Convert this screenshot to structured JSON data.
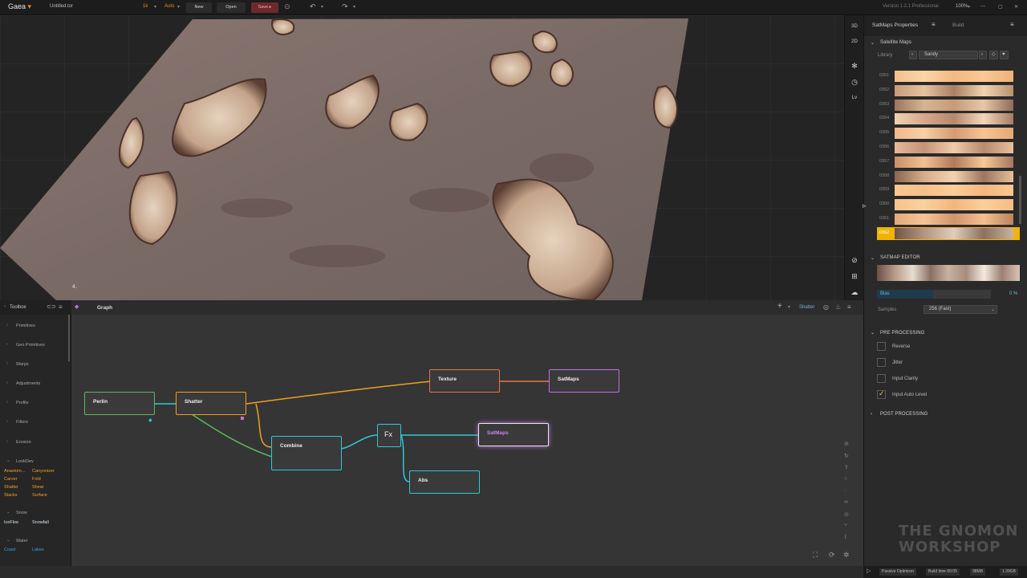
{
  "topbar": {
    "app_name": "Gaea",
    "file_name": "Untitled.tor",
    "resolution": "1k",
    "mode": "Auto",
    "new_label": "New",
    "open_label": "Open",
    "save_label": "Save ▸",
    "version": "Version 1.2.1 Professional",
    "zoom": "100%"
  },
  "viewport": {
    "tools": [
      "3D",
      "2D",
      "Lv"
    ]
  },
  "right_panel": {
    "tab_properties": "SatMaps Properties",
    "tab_build": "Build",
    "section_satellite": "Satellite Maps",
    "library_label": "Library",
    "library_value": "Sandy",
    "swatches": [
      {
        "id": "0351",
        "colors": [
          "#f3c08c",
          "#fad5a5",
          "#f4b881",
          "#f9c894",
          "#f0b07a"
        ]
      },
      {
        "id": "0352",
        "colors": [
          "#c79a78",
          "#e6c3a0",
          "#a87f64",
          "#f1d4b0",
          "#b89274"
        ]
      },
      {
        "id": "0353",
        "colors": [
          "#9b7560",
          "#d9b492",
          "#c69b79",
          "#e8c7a6",
          "#8e6b58"
        ]
      },
      {
        "id": "0354",
        "colors": [
          "#f0d2b4",
          "#d6a88a",
          "#b7876d",
          "#f4d6b9",
          "#a47b64"
        ]
      },
      {
        "id": "0355",
        "colors": [
          "#efb98b",
          "#f8d0a6",
          "#d49b73",
          "#f6c493",
          "#e8a874"
        ]
      },
      {
        "id": "0356",
        "colors": [
          "#e6b896",
          "#c49478",
          "#f1cba8",
          "#b88a6e",
          "#e9bf9b"
        ]
      },
      {
        "id": "0357",
        "colors": [
          "#c68f68",
          "#f2c094",
          "#b17a5a",
          "#f6c998",
          "#a6765c"
        ]
      },
      {
        "id": "0358",
        "colors": [
          "#8a6650",
          "#d8ad8a",
          "#f3d2b0",
          "#9c7660",
          "#e8bf99"
        ]
      },
      {
        "id": "0359",
        "colors": [
          "#fac890",
          "#f6c08a",
          "#fbcd98",
          "#f2b880",
          "#f9c68f"
        ]
      },
      {
        "id": "0360",
        "colors": [
          "#f7c28c",
          "#fbd19e",
          "#f3b57e",
          "#fbcf9a",
          "#f5bd86"
        ]
      },
      {
        "id": "0361",
        "colors": [
          "#e2a87c",
          "#f6c596",
          "#cf946c",
          "#f3bf8f",
          "#b9835f"
        ]
      },
      {
        "id": "0362",
        "colors": [
          "#6e5448",
          "#b39582",
          "#e0cdbd",
          "#8c7062",
          "#c9b3a3"
        ]
      }
    ],
    "section_editor": "SATMAP EDITOR",
    "bias_label": "Bias",
    "bias_value": "0 %",
    "samples_label": "Samples",
    "samples_value": "256 (Fast)",
    "section_pre": "PRE PROCESSING",
    "checks": [
      {
        "label": "Reverse",
        "checked": false
      },
      {
        "label": "Jitter",
        "checked": false
      },
      {
        "label": "Input Clarity",
        "checked": false
      },
      {
        "label": "Input Auto Level",
        "checked": true
      }
    ],
    "section_post": "POST PROCESSING"
  },
  "toolbox": {
    "title": "Toolbox",
    "categories": [
      "Primitives",
      "Geo Primitives",
      "Warps",
      "Adjustments",
      "Profile",
      "Filters",
      "Erosion",
      "LookDev",
      "Snow",
      "Water"
    ],
    "lookdev_nodes": [
      "Anastom...",
      "Canyonizer",
      "Carver",
      "Fold",
      "Shatter",
      "Shear",
      "Stacks",
      "Surface"
    ],
    "snow_nodes": [
      "IceFloe",
      "Snowfall"
    ],
    "water_nodes": [
      "Coast",
      "Lakes"
    ]
  },
  "graph": {
    "title": "Graph",
    "active_node": "Shatter",
    "nodes": {
      "perlin": "Perlin",
      "shatter": "Shatter",
      "texture": "Texture",
      "satmaps_top": "SatMaps",
      "combine": "Combine",
      "fx": "Fx",
      "satmaps_mid": "SatMaps",
      "abs": "Abs"
    }
  },
  "status": {
    "optimizer": "Passive Optimizer",
    "build_time": "Build time 00:05",
    "memory": "98MB",
    "disk": "1.39GB"
  },
  "watermark": {
    "line1": "THE GNOMON",
    "line2": "WORKSHOP"
  },
  "colors": {
    "accent_orange": "#f08a24",
    "selected_swatch": "#f0b400",
    "perlin": "#5cb85c",
    "shatter": "#f0a020",
    "texture": "#e8744a",
    "satmaps": "#c070e0",
    "cyan": "#2ec8d8"
  }
}
